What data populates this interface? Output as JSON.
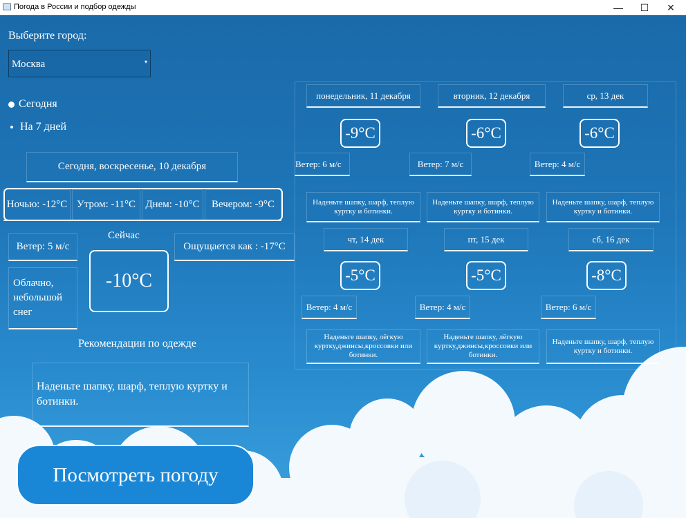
{
  "window": {
    "title": "Погода в России и подбор одежды",
    "minimize": "—",
    "maximize": "☐",
    "close": "✕"
  },
  "city": {
    "label": "Выберите город:",
    "selected": "Москва",
    "arrow": "▾"
  },
  "period": {
    "today": "Сегодня",
    "week": "На 7 дней"
  },
  "today": {
    "date": "Сегодня, воскресенье, 10 декабря",
    "night": "Ночью: -12°C",
    "morning": "Утром: -11°C",
    "day": "Днем: -10°C",
    "evening": "Вечером: -9°C",
    "wind": "Ветер: 5 м/с",
    "now_label": "Сейчас",
    "now_temp": "-10°C",
    "feels": "Ощущается как : -17°C",
    "condition": "Облачно, небольшой снег",
    "rec_title": "Рекомендации по одежде",
    "rec_text": "Наденьте шапку, шарф, теплую куртку и ботинки."
  },
  "forecast": [
    {
      "date": "понедельник, 11 декабря",
      "temp": "-9°C",
      "wind": "Ветер: 6 м/с",
      "rec": "Наденьте шапку, шарф, теплую куртку и ботинки."
    },
    {
      "date": "вторник, 12 декабря",
      "temp": "-6°C",
      "wind": "Ветер: 7 м/с",
      "rec": "Наденьте шапку, шарф, теплую куртку и ботинки."
    },
    {
      "date": "ср, 13 дек",
      "temp": "-6°C",
      "wind": "Ветер: 4 м/с",
      "rec": "Наденьте шапку, шарф, теплую куртку и ботинки."
    },
    {
      "date": "чт, 14 дек",
      "temp": "-5°C",
      "wind": "Ветер: 4 м/с",
      "rec": "Наденьте шапку, лёгкую куртку,джинсы,кроссовки или ботинки."
    },
    {
      "date": "пт, 15 дек",
      "temp": "-5°C",
      "wind": "Ветер: 4 м/с",
      "rec": "Наденьте шапку, лёгкую куртку,джинсы,кроссовки или ботинки."
    },
    {
      "date": "сб, 16 дек",
      "temp": "-8°C",
      "wind": "Ветер: 6 м/с",
      "rec": "Наденьте шапку, шарф, теплую куртку и ботинки."
    }
  ],
  "action": {
    "label": "Посмотреть погоду"
  }
}
